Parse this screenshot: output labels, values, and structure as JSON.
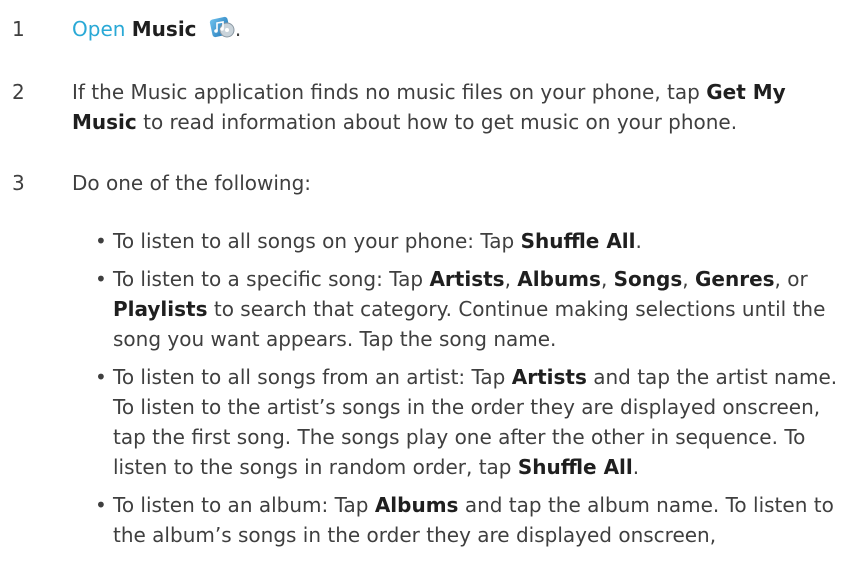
{
  "steps": [
    {
      "number": "1",
      "link_text": "Open",
      "bold_text": "Music",
      "icon": "music-app-icon",
      "suffix": "."
    },
    {
      "number": "2",
      "text_before": "If the Music application finds no music files on your phone, tap ",
      "bold_text": "Get My Music",
      "text_after": " to read information about how to get music on your phone."
    },
    {
      "number": "3",
      "text": "Do one of the following:"
    }
  ],
  "bullets": [
    {
      "parts": [
        {
          "t": "To listen to all songs on your phone: Tap "
        },
        {
          "b": "Shuffle All"
        },
        {
          "t": "."
        }
      ]
    },
    {
      "parts": [
        {
          "t": "To listen to a specific song: Tap "
        },
        {
          "b": "Artists"
        },
        {
          "t": ", "
        },
        {
          "b": "Albums"
        },
        {
          "t": ", "
        },
        {
          "b": "Songs"
        },
        {
          "t": ", "
        },
        {
          "b": "Genres"
        },
        {
          "t": ", or "
        },
        {
          "b": "Playlists"
        },
        {
          "t": " to search that category. Continue making selections until the song you want appears. Tap the song name."
        }
      ]
    },
    {
      "parts": [
        {
          "t": "To listen to all songs from an artist: Tap "
        },
        {
          "b": "Artists"
        },
        {
          "t": " and tap the artist name. To listen to the artist’s songs in the order they are displayed onscreen, tap the first song. The songs play one after the other in sequence. To listen to the songs in random order, tap "
        },
        {
          "b": "Shuffle All"
        },
        {
          "t": "."
        }
      ]
    },
    {
      "parts": [
        {
          "t": "To listen to an album: Tap "
        },
        {
          "b": "Albums"
        },
        {
          "t": " and tap the album name. To listen to the album’s songs in the order they are displayed onscreen,"
        }
      ]
    }
  ],
  "bullet_char": "•",
  "colors": {
    "text": "#3f3f3f",
    "link": "#2aa9d6",
    "bold": "#1f1f1f"
  }
}
